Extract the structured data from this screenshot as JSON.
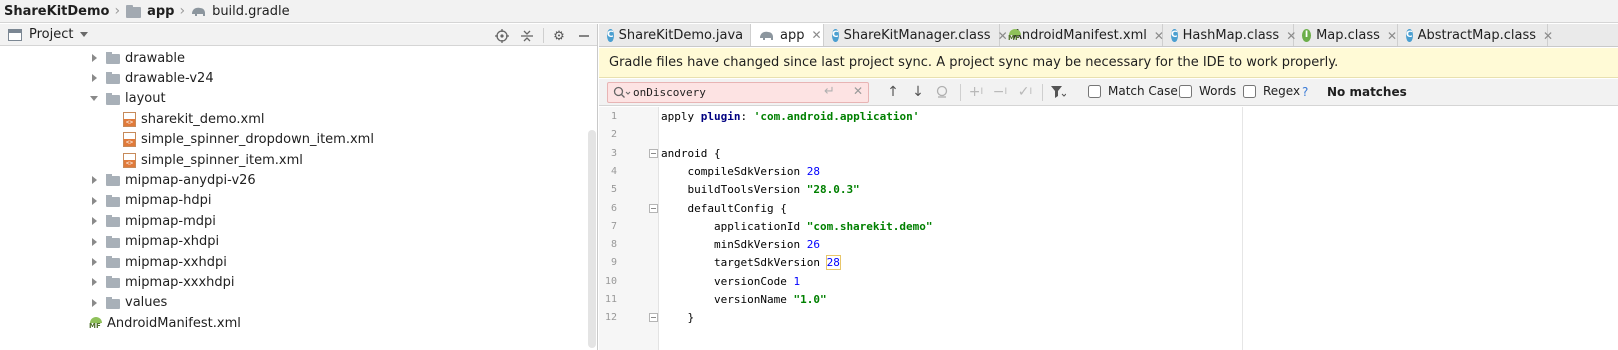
{
  "breadcrumb": {
    "project": "ShareKitDemo",
    "module": "app",
    "file": "build.gradle"
  },
  "project_panel": {
    "title": "Project",
    "tree": [
      {
        "label": "drawable",
        "type": "folder",
        "expanded": false
      },
      {
        "label": "drawable-v24",
        "type": "folder",
        "expanded": false
      },
      {
        "label": "layout",
        "type": "folder",
        "expanded": true
      },
      {
        "label": "sharekit_demo.xml",
        "type": "xml-file"
      },
      {
        "label": "simple_spinner_dropdown_item.xml",
        "type": "xml-file"
      },
      {
        "label": "simple_spinner_item.xml",
        "type": "xml-file"
      },
      {
        "label": "mipmap-anydpi-v26",
        "type": "folder",
        "expanded": false
      },
      {
        "label": "mipmap-hdpi",
        "type": "folder",
        "expanded": false
      },
      {
        "label": "mipmap-mdpi",
        "type": "folder",
        "expanded": false
      },
      {
        "label": "mipmap-xhdpi",
        "type": "folder",
        "expanded": false
      },
      {
        "label": "mipmap-xxhdpi",
        "type": "folder",
        "expanded": false
      },
      {
        "label": "mipmap-xxxhdpi",
        "type": "folder",
        "expanded": false
      },
      {
        "label": "values",
        "type": "folder",
        "expanded": false
      },
      {
        "label": "AndroidManifest.xml",
        "type": "manifest-file"
      }
    ]
  },
  "editor_tabs": [
    {
      "label": "ShareKitDemo.java",
      "icon": "class-icon",
      "active": false
    },
    {
      "label": "app",
      "icon": "gradle-icon",
      "active": true
    },
    {
      "label": "ShareKitManager.class",
      "icon": "class-icon",
      "active": false
    },
    {
      "label": "AndroidManifest.xml",
      "icon": "manifest-icon",
      "active": false
    },
    {
      "label": "HashMap.class",
      "icon": "class-icon",
      "active": false
    },
    {
      "label": "Map.class",
      "icon": "interface-icon",
      "active": false
    },
    {
      "label": "AbstractMap.class",
      "icon": "class-icon",
      "active": false
    }
  ],
  "banner": {
    "message": "Gradle files have changed since last project sync. A project sync may be necessary for the IDE to work properly."
  },
  "find": {
    "query": "onDiscovery",
    "match_case_label": "Match Case",
    "words_label": "Words",
    "regex_label": "Regex",
    "regex_help": "?",
    "status": "No matches"
  },
  "code_lines": [
    {
      "n": "1",
      "parts": [
        [
          "plain",
          "apply "
        ],
        [
          "kw",
          "plugin"
        ],
        [
          "plain",
          ": "
        ],
        [
          "str",
          "'com.android.application'"
        ]
      ]
    },
    {
      "n": "2",
      "parts": []
    },
    {
      "n": "3",
      "fold": true,
      "parts": [
        [
          "plain",
          "android {"
        ]
      ]
    },
    {
      "n": "4",
      "parts": [
        [
          "plain",
          "    compileSdkVersion "
        ],
        [
          "num",
          "28"
        ]
      ]
    },
    {
      "n": "5",
      "parts": [
        [
          "plain",
          "    buildToolsVersion "
        ],
        [
          "str",
          "\"28.0.3\""
        ]
      ]
    },
    {
      "n": "6",
      "fold": true,
      "parts": [
        [
          "plain",
          "    defaultConfig {"
        ]
      ]
    },
    {
      "n": "7",
      "parts": [
        [
          "plain",
          "        applicationId "
        ],
        [
          "str",
          "\"com.sharekit.demo\""
        ]
      ]
    },
    {
      "n": "8",
      "parts": [
        [
          "plain",
          "        minSdkVersion "
        ],
        [
          "num",
          "26"
        ]
      ]
    },
    {
      "n": "9",
      "parts": [
        [
          "plain",
          "        targetSdkVersion "
        ],
        [
          "num-hl",
          "28"
        ]
      ]
    },
    {
      "n": "10",
      "parts": [
        [
          "plain",
          "        versionCode "
        ],
        [
          "num",
          "1"
        ]
      ]
    },
    {
      "n": "11",
      "parts": [
        [
          "plain",
          "        versionName "
        ],
        [
          "str",
          "\"1.0\""
        ]
      ]
    },
    {
      "n": "12",
      "fold": true,
      "parts": [
        [
          "plain",
          "    }"
        ]
      ]
    }
  ]
}
